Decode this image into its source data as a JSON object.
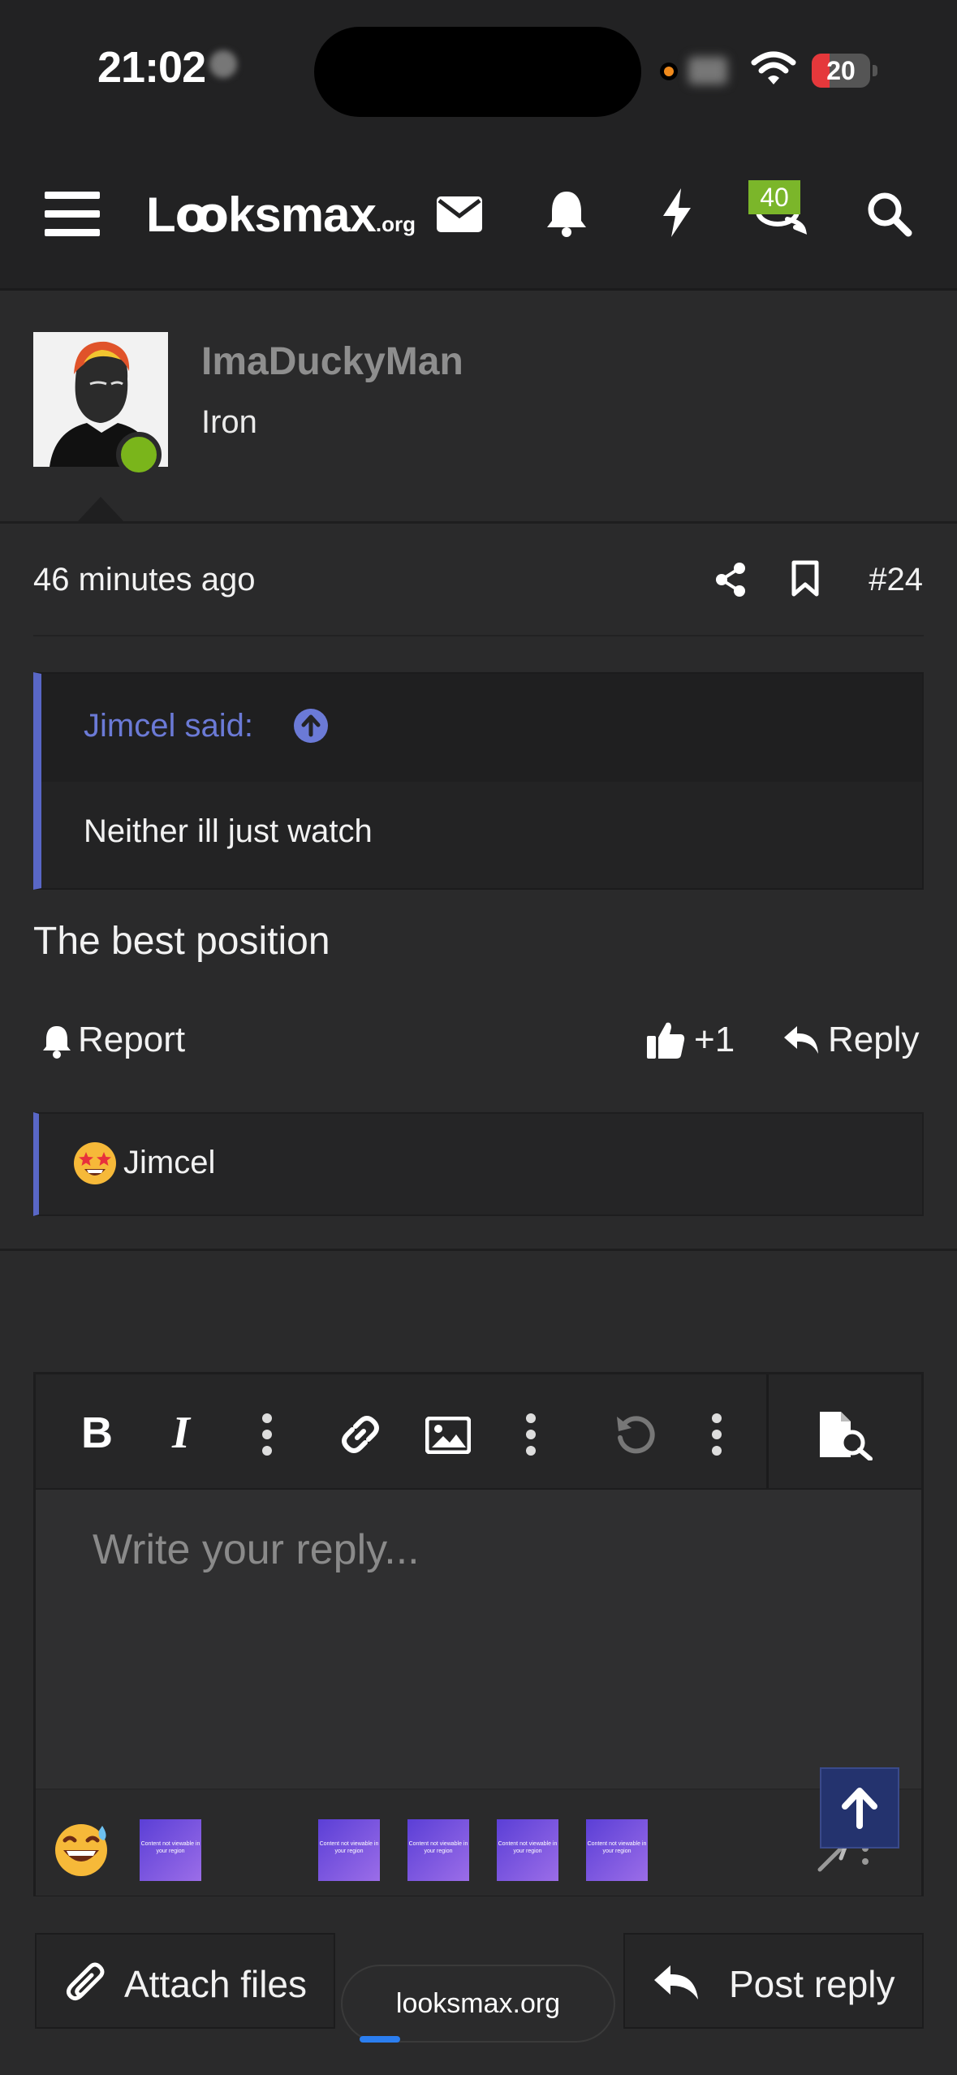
{
  "status_bar": {
    "time": "21:02",
    "battery": "20"
  },
  "header": {
    "logo_main": "Lꝏksmax",
    "logo_suffix": ".org",
    "icons": [
      "menu-icon",
      "envelope-icon",
      "bell-icon",
      "bolt-icon",
      "chat-icon",
      "search-icon"
    ],
    "chat_badge": "40"
  },
  "post": {
    "username": "ImaDuckyMan",
    "rank": "Iron",
    "time_ago": "46 minutes ago",
    "post_number": "#24",
    "quote": {
      "attribution": "Jimcel said:",
      "text": "Neither ill just watch"
    },
    "message": "The best position",
    "actions": {
      "report": "Report",
      "like_count": "+1",
      "reply": "Reply"
    },
    "reactions": [
      {
        "emoji": "star-struck",
        "user": "Jimcel"
      }
    ]
  },
  "editor": {
    "toolbar_icons": [
      "bold-icon",
      "italic-icon",
      "more-icon",
      "link-icon",
      "image-icon",
      "more-icon",
      "undo-icon",
      "more-icon",
      "preview-icon"
    ],
    "placeholder": "Write your reply...",
    "smiley_thumbnail_text": "Content not viewable in your region"
  },
  "bottom": {
    "attach_label": "Attach files",
    "url": "looksmax.org",
    "post_reply_label": "Post reply"
  },
  "colors": {
    "accent": "#5967c6",
    "online": "#7ab51b",
    "badge": "#7bb62a",
    "background": "#2a2a2b"
  }
}
